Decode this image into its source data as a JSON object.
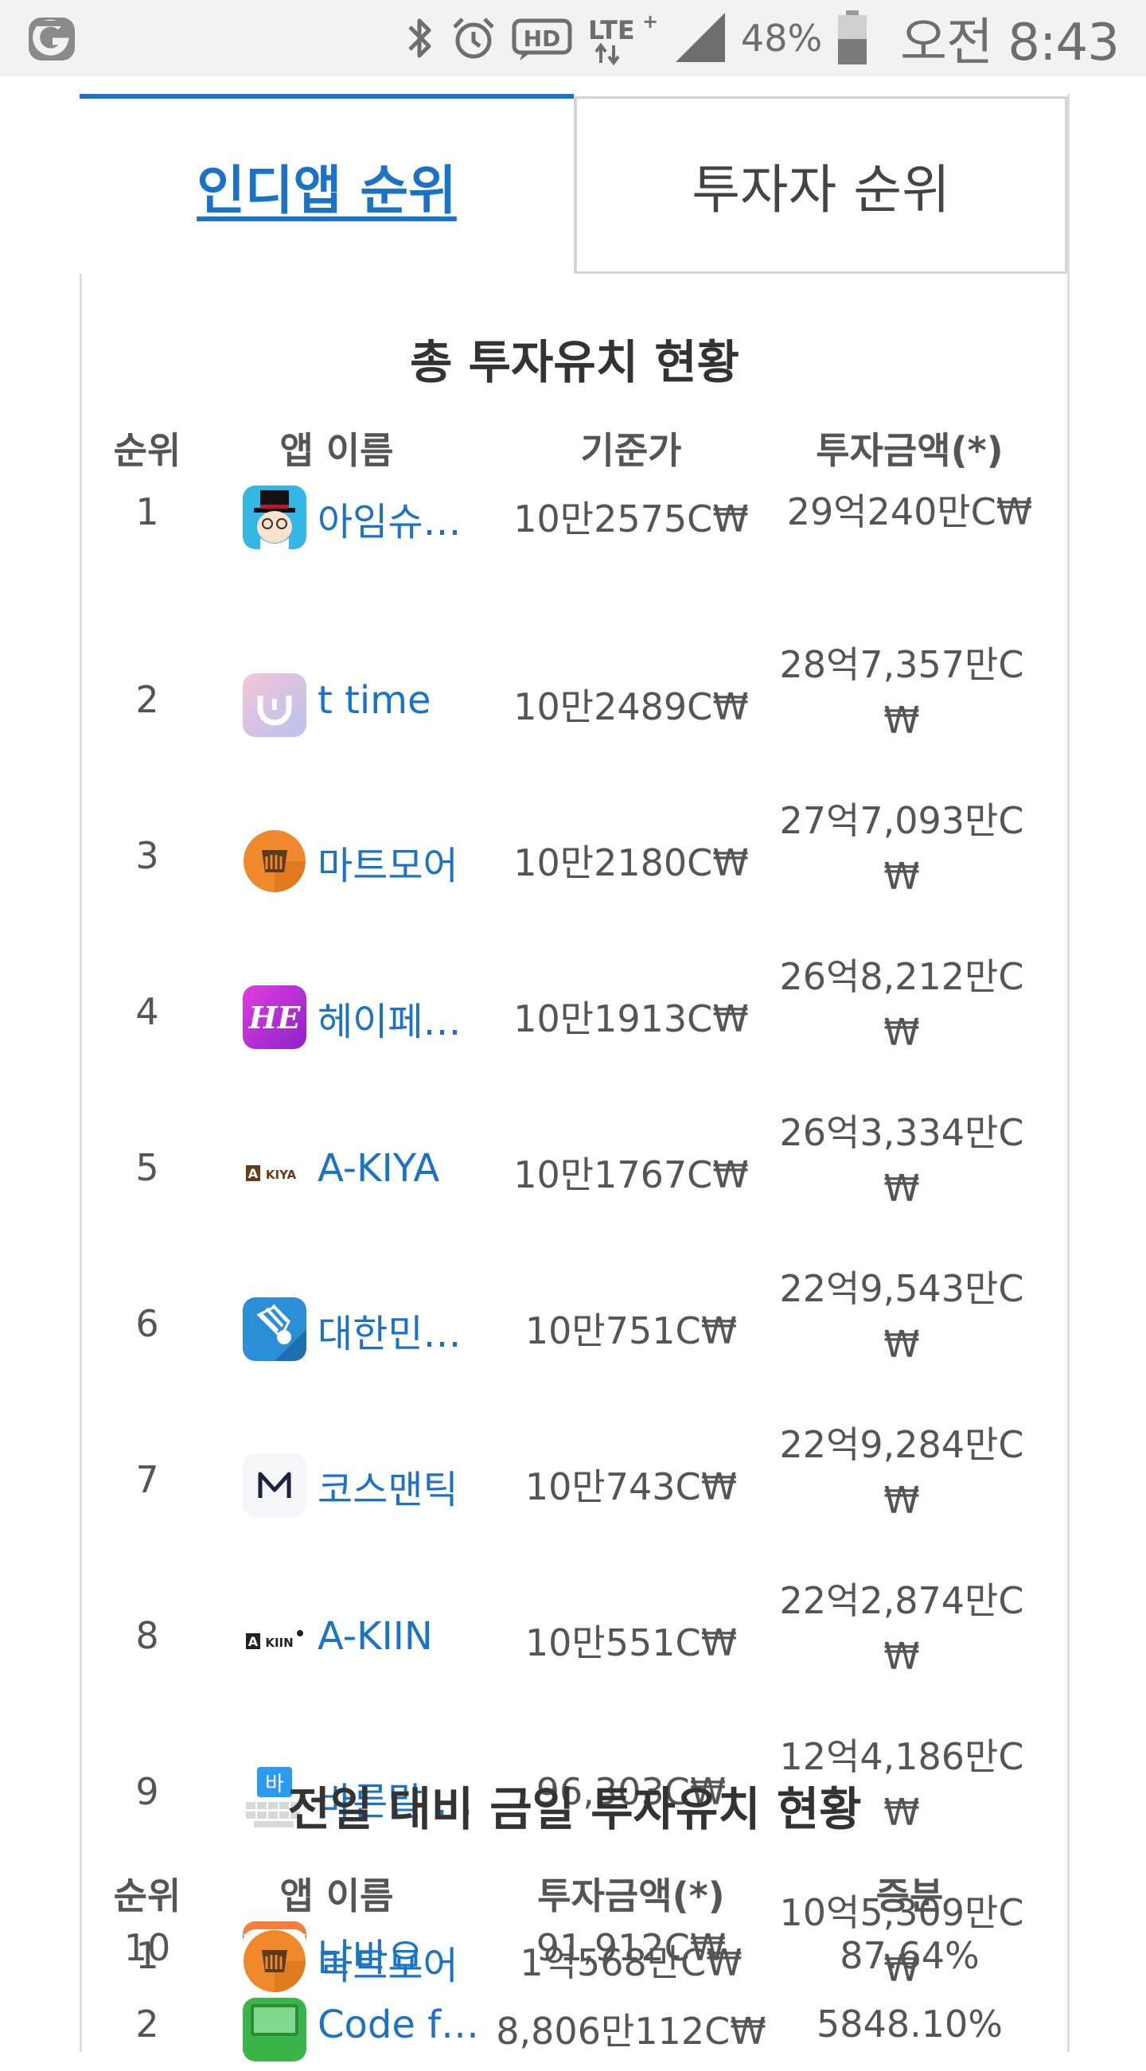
{
  "status_bar": {
    "battery_pct": "48%",
    "time": "오전 8:43",
    "icons": [
      "carrier-logo-icon",
      "bluetooth-icon",
      "alarm-icon",
      "hd-voice-icon",
      "lte-plus-icon",
      "signal-icon",
      "battery-icon"
    ]
  },
  "tabs": {
    "active": "인디앱 순위",
    "inactive": "투자자 순위"
  },
  "total": {
    "title": "총 투자유치 현황",
    "headers": {
      "rank": "순위",
      "name": "앱 이름",
      "price": "기준가",
      "amount": "투자금액(*)"
    },
    "rows": [
      {
        "rank": "1",
        "name": "아임슈…",
        "price": "10만2575C₩",
        "amount": "29억240만C₩",
        "icon": "professor-icon"
      },
      {
        "rank": "2",
        "name": "t time",
        "price": "10만2489C₩",
        "amount": "28억7,357만C₩",
        "icon": "t-time-icon"
      },
      {
        "rank": "3",
        "name": "마트모어",
        "price": "10만2180C₩",
        "amount": "27억7,093만C₩",
        "icon": "martmore-icon"
      },
      {
        "rank": "4",
        "name": "헤이페…",
        "price": "10만1913C₩",
        "amount": "26억8,212만C₩",
        "icon": "heype-icon"
      },
      {
        "rank": "5",
        "name": "A-KIYA",
        "price": "10만1767C₩",
        "amount": "26억3,334만C₩",
        "icon": "akiya-icon"
      },
      {
        "rank": "6",
        "name": "대한민…",
        "price": "10만751C₩",
        "amount": "22억9,543만C₩",
        "icon": "shuttlecock-icon"
      },
      {
        "rank": "7",
        "name": "코스맨틱",
        "price": "10만743C₩",
        "amount": "22억9,284만C₩",
        "icon": "cosmantic-icon"
      },
      {
        "rank": "8",
        "name": "A-KIIN",
        "price": "10만551C₩",
        "amount": "22억2,874만C₩",
        "icon": "akiin-icon"
      },
      {
        "rank": "9",
        "name": "바른말 …",
        "price": "96,303C₩",
        "amount": "12억4,186만C₩",
        "icon": "keyboard-icon"
      },
      {
        "rank": "10",
        "name": "날바요",
        "price": "91,912C₩",
        "amount": "10억5,309만C₩",
        "icon": "nalbayo-icon"
      }
    ]
  },
  "daily": {
    "title": "전일 대비 금일 투자유치 현황",
    "headers": {
      "rank": "순위",
      "name": "앱 이름",
      "amount": "투자금액(*)",
      "change": "증분"
    },
    "rows": [
      {
        "rank": "1",
        "name": "마트모어",
        "amount": "1억568만C₩",
        "change": "87.64%",
        "icon": "martmore-icon"
      },
      {
        "rank": "2",
        "name": "Code f…",
        "amount": "8,806만112C₩",
        "change": "5848.10%",
        "icon": "code-icon"
      }
    ]
  },
  "colors": {
    "accent": "#1a73c5",
    "text": "#555555",
    "border": "#dcdcdc"
  }
}
